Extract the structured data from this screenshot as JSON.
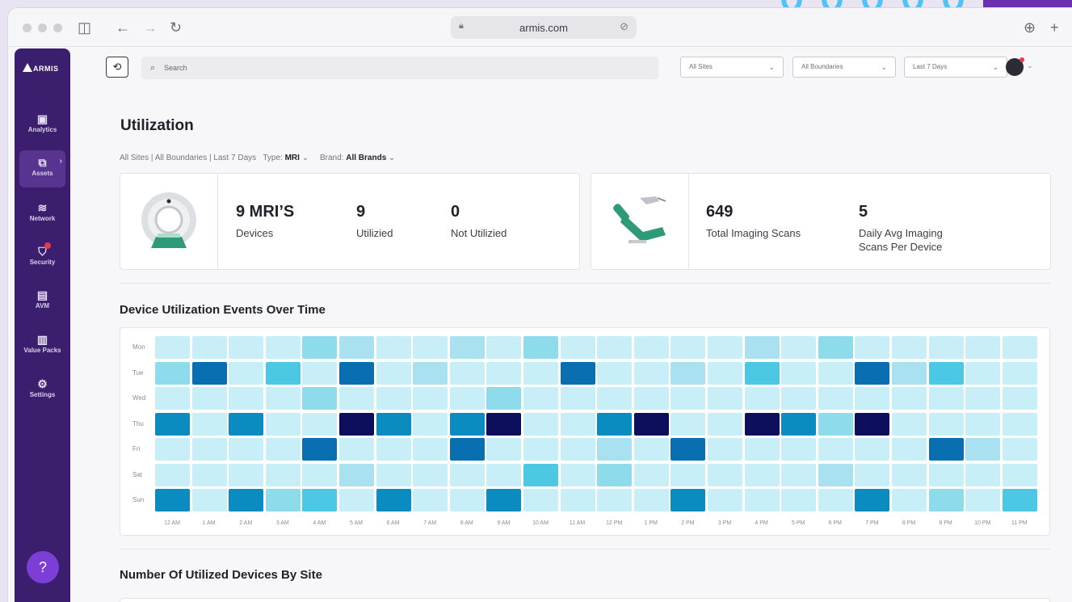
{
  "browser": {
    "url": "armis.com",
    "icons": [
      "sidebar-toggle-icon",
      "back-icon",
      "forward-icon",
      "reload-icon",
      "lock-icon",
      "share-icon",
      "download-icon",
      "new-tab-icon"
    ]
  },
  "brand": {
    "logo_text": "ARMIS",
    "colors": {
      "primary": "#3b1e6d",
      "accent": "#7c3ed6",
      "heat_low": "#c8eef7",
      "heat_high": "#0d0f5c"
    }
  },
  "sidebar": {
    "items": [
      {
        "label": "Analytics",
        "icon": "analytics-icon"
      },
      {
        "label": "Assets",
        "icon": "assets-icon",
        "active": true
      },
      {
        "label": "Network",
        "icon": "network-icon"
      },
      {
        "label": "Security",
        "icon": "security-icon"
      },
      {
        "label": "AVM",
        "icon": "avm-icon"
      },
      {
        "label": "Value Packs",
        "icon": "value-packs-icon"
      },
      {
        "label": "Settings",
        "icon": "settings-icon"
      }
    ],
    "help_icon": "help-chat-icon"
  },
  "topbar": {
    "search_placeholder": "Search",
    "dropdowns": [
      {
        "value": "All Sites"
      },
      {
        "value": "All Boundaries"
      },
      {
        "value": "Last 7 Days"
      }
    ]
  },
  "page": {
    "title": "Utilization",
    "breadcrumb": "All Sites | All Boundaries | Last 7 Days",
    "type_label": "Type:",
    "type_value": "MRI",
    "brand_label": "Brand:",
    "brand_value": "All Brands"
  },
  "cards": {
    "devices": {
      "stats": [
        {
          "value": "9 MRI’S",
          "label": "Devices"
        },
        {
          "value": "9",
          "label": "Utilizied"
        },
        {
          "value": "0",
          "label": "Not Utilizied"
        }
      ]
    },
    "scans": {
      "stats": [
        {
          "value": "649",
          "label": "Total Imaging Scans"
        },
        {
          "value": "5",
          "label": "Daily Avg Imaging Scans Per Device"
        }
      ]
    }
  },
  "heatmap_section": {
    "title": "Device Utilization Events Over Time",
    "days": [
      "Mon",
      "Tue",
      "Wed",
      "Thu",
      "Fri",
      "Sat",
      "Sun"
    ],
    "hours": [
      "12 AM",
      "1 AM",
      "2 AM",
      "3 AM",
      "4 AM",
      "5 AM",
      "6 AM",
      "7 AM",
      "8 AM",
      "9 AM",
      "10 AM",
      "11 AM",
      "12 PM",
      "1 PM",
      "2 PM",
      "3 PM",
      "4 PM",
      "5 PM",
      "6 PM",
      "7 PM",
      "8 PM",
      "9 PM",
      "10 PM",
      "11 PM"
    ],
    "levels": [
      [
        0,
        0,
        0,
        0,
        2,
        1,
        0,
        0,
        1,
        0,
        2,
        0,
        0,
        0,
        0,
        0,
        1,
        0,
        2,
        0,
        0,
        0,
        0,
        0
      ],
      [
        2,
        5,
        0,
        3,
        0,
        5,
        0,
        1,
        0,
        0,
        0,
        5,
        0,
        0,
        1,
        0,
        3,
        0,
        0,
        5,
        1,
        3,
        0,
        0
      ],
      [
        0,
        0,
        0,
        0,
        2,
        0,
        0,
        0,
        0,
        2,
        0,
        0,
        0,
        0,
        0,
        0,
        0,
        0,
        0,
        0,
        0,
        0,
        0,
        0
      ],
      [
        4,
        0,
        4,
        0,
        0,
        6,
        4,
        0,
        4,
        6,
        0,
        0,
        4,
        6,
        0,
        0,
        6,
        4,
        2,
        6,
        0,
        0,
        0,
        0
      ],
      [
        0,
        0,
        0,
        0,
        5,
        0,
        0,
        0,
        5,
        0,
        0,
        0,
        1,
        0,
        5,
        0,
        0,
        0,
        0,
        0,
        0,
        5,
        1,
        0
      ],
      [
        0,
        0,
        0,
        0,
        0,
        1,
        0,
        0,
        0,
        0,
        3,
        0,
        2,
        0,
        0,
        0,
        0,
        0,
        1,
        0,
        0,
        0,
        0,
        0
      ],
      [
        4,
        0,
        4,
        2,
        3,
        0,
        4,
        0,
        0,
        4,
        0,
        0,
        0,
        0,
        4,
        0,
        0,
        0,
        0,
        4,
        0,
        2,
        0,
        3
      ]
    ]
  },
  "sites_section": {
    "title": "Number Of Utilized Devices By Site"
  }
}
